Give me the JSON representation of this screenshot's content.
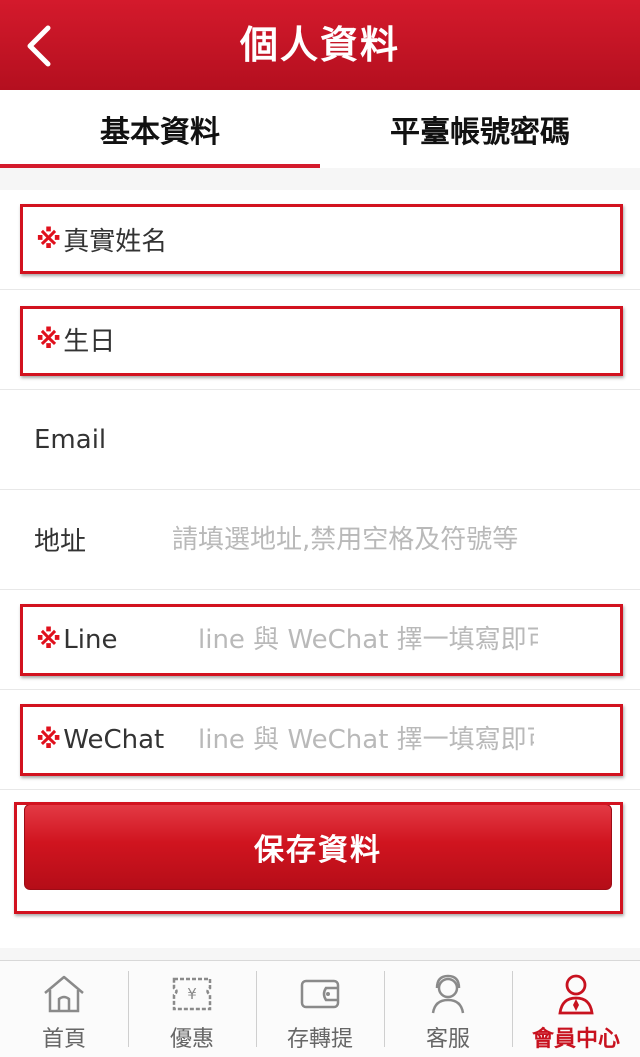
{
  "header": {
    "title": "個人資料",
    "back_icon": "chevron-left-icon"
  },
  "tabs": [
    {
      "label": "基本資料",
      "active": true
    },
    {
      "label": "平臺帳號密碼",
      "active": false
    }
  ],
  "form": {
    "required_mark": "※",
    "real_name": {
      "label": "真實姓名",
      "value": ""
    },
    "birthday": {
      "label": "生日",
      "value": ""
    },
    "email": {
      "label": "Email",
      "value": ""
    },
    "address": {
      "label": "地址",
      "placeholder": "請填選地址,禁用空格及符號等"
    },
    "line": {
      "label": "Line",
      "placeholder": "line 與 WeChat 擇一填寫即可"
    },
    "wechat": {
      "label": "WeChat",
      "placeholder": "line 與 WeChat 擇一填寫即可"
    }
  },
  "save_button": {
    "label": "保存資料"
  },
  "bottom_nav": [
    {
      "label": "首頁",
      "icon": "home-icon",
      "active": false
    },
    {
      "label": "優惠",
      "icon": "coupon-icon",
      "active": false
    },
    {
      "label": "存轉提",
      "icon": "wallet-icon",
      "active": false
    },
    {
      "label": "客服",
      "icon": "support-agent-icon",
      "active": false
    },
    {
      "label": "會員中心",
      "icon": "member-icon",
      "active": true
    }
  ],
  "colors": {
    "brand_red": "#d41a2c",
    "highlight_frame": "#d2121f"
  }
}
